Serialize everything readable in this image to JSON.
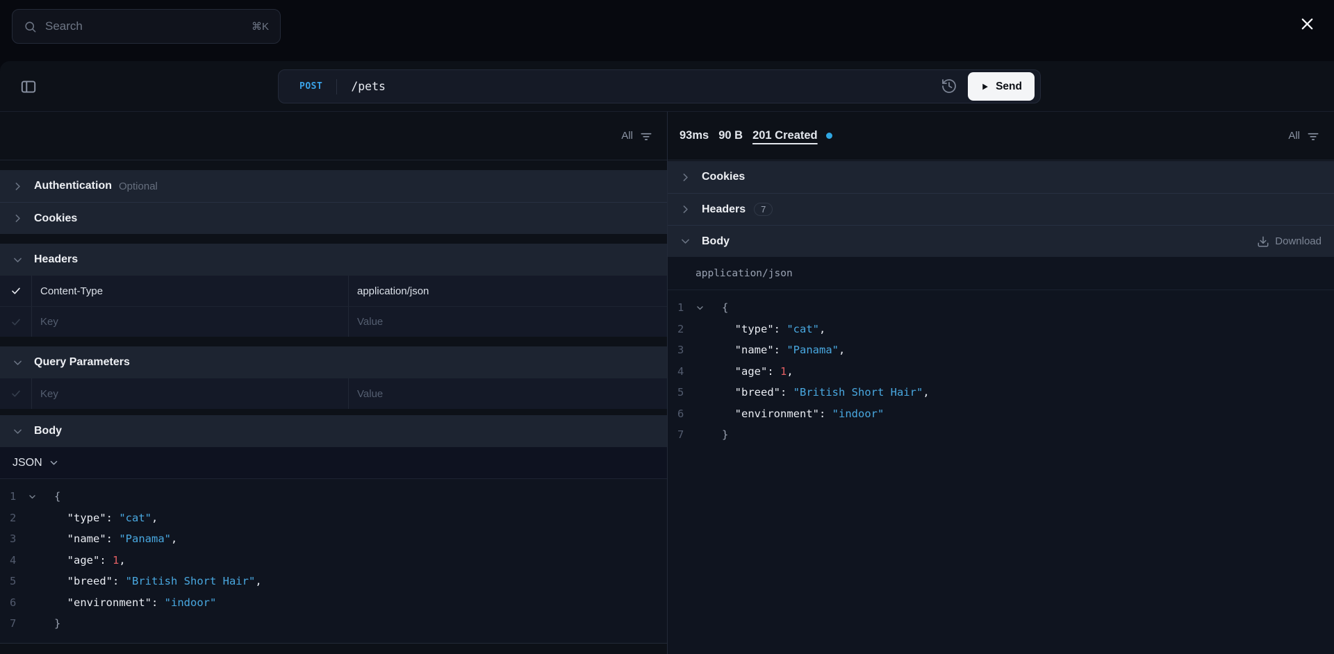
{
  "topbar": {
    "search_placeholder": "Search",
    "search_shortcut": "⌘K"
  },
  "request_bar": {
    "method": "POST",
    "path": "/pets",
    "send_label": "Send"
  },
  "request_panel": {
    "filter_label": "All",
    "auth_title": "Authentication",
    "auth_badge": "Optional",
    "cookies_title": "Cookies",
    "headers_title": "Headers",
    "header_rows": {
      "row1": {
        "key": "Content-Type",
        "value": "application/json",
        "checked": true
      }
    },
    "key_placeholder": "Key",
    "value_placeholder": "Value",
    "query_params_title": "Query Parameters",
    "body_title": "Body",
    "body_format": "JSON"
  },
  "response_panel": {
    "filter_label": "All",
    "status_time": "93ms",
    "status_size": "90 B",
    "status_code": "201 Created",
    "cookies_title": "Cookies",
    "headers_title": "Headers",
    "headers_count": "7",
    "body_title": "Body",
    "download_label": "Download",
    "content_type": "application/json"
  },
  "code": {
    "lines": [
      {
        "n": "1",
        "caret": true,
        "tokens": [
          {
            "c": "brace",
            "t": "{"
          }
        ]
      },
      {
        "n": "2",
        "caret": false,
        "tokens": [
          {
            "c": "key",
            "t": "  \"type\""
          },
          {
            "c": "p",
            "t": ": "
          },
          {
            "c": "str",
            "t": "\"cat\""
          },
          {
            "c": "p",
            "t": ","
          }
        ]
      },
      {
        "n": "3",
        "caret": false,
        "tokens": [
          {
            "c": "key",
            "t": "  \"name\""
          },
          {
            "c": "p",
            "t": ": "
          },
          {
            "c": "str",
            "t": "\"Panama\""
          },
          {
            "c": "p",
            "t": ","
          }
        ]
      },
      {
        "n": "4",
        "caret": false,
        "tokens": [
          {
            "c": "key",
            "t": "  \"age\""
          },
          {
            "c": "p",
            "t": ": "
          },
          {
            "c": "num",
            "t": "1"
          },
          {
            "c": "p",
            "t": ","
          }
        ]
      },
      {
        "n": "5",
        "caret": false,
        "tokens": [
          {
            "c": "key",
            "t": "  \"breed\""
          },
          {
            "c": "p",
            "t": ": "
          },
          {
            "c": "str",
            "t": "\"British Short Hair\""
          },
          {
            "c": "p",
            "t": ","
          }
        ]
      },
      {
        "n": "6",
        "caret": false,
        "tokens": [
          {
            "c": "key",
            "t": "  \"environment\""
          },
          {
            "c": "p",
            "t": ": "
          },
          {
            "c": "str",
            "t": "\"indoor\""
          }
        ]
      },
      {
        "n": "7",
        "caret": false,
        "tokens": [
          {
            "c": "brace",
            "t": "}"
          }
        ]
      }
    ]
  },
  "icons": {
    "search": "magnifier",
    "close": "x",
    "sidebar_toggle": "panel-left",
    "history": "clock-rewind",
    "send_play": "play-triangle",
    "filter": "filter-lines",
    "chevron_right": "chevron-right",
    "chevron_down": "chevron-down",
    "check": "checkmark",
    "download": "arrow-down-to-tray",
    "status_dot": "circle"
  },
  "colors": {
    "accent_blue": "#3aa2e8",
    "status_dot": "#2fa7e2",
    "code_string": "#49a8e0",
    "code_number": "#e25f63",
    "send_button_bg": "#f4f5f7",
    "section_header_bg": "#1d2431",
    "window_bg": "#0d1118"
  }
}
